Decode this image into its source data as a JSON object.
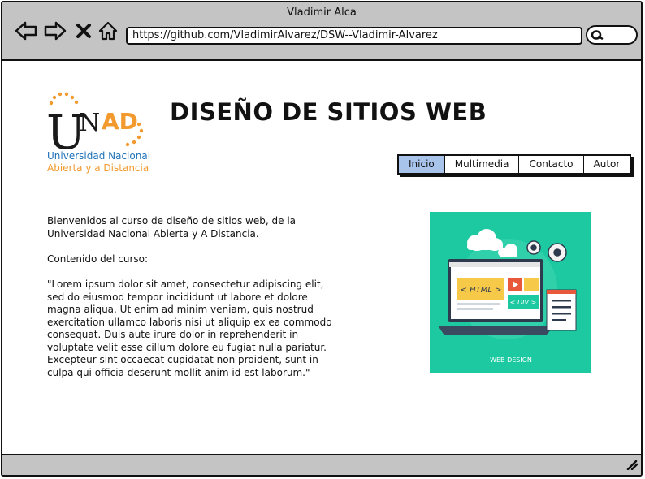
{
  "window": {
    "title": "Vladimir Alca"
  },
  "browser": {
    "url": "https://github.com/VladimirAlvarez/DSW--Vladimir-Alvarez",
    "nav_icons": [
      "back-icon",
      "forward-icon",
      "close-icon",
      "home-icon"
    ],
    "search_icon": "search-icon"
  },
  "logo": {
    "word_u": "U",
    "word_n": "N",
    "word_ad": "AD",
    "line1": "Universidad Nacional",
    "line2": "Abierta y a Distancia",
    "colors": {
      "black": "#1a1a1a",
      "orange": "#f29a2e",
      "blue": "#1f72b8"
    }
  },
  "page": {
    "title": "DISEÑO DE SITIOS WEB"
  },
  "nav": {
    "items": [
      "Inicio",
      "Multimedia",
      "Contacto",
      "Autor"
    ],
    "active": "Inicio",
    "active_color": "#a9c4eb"
  },
  "content": {
    "intro": "Bienvenidos al curso de diseño de sitios web, de la Universidad Nacional Abierta y A Distancia.",
    "course_label": "Contenido del curso:",
    "lorem": "\"Lorem ipsum dolor sit amet, consectetur adipiscing elit, sed do eiusmod tempor incididunt ut labore et dolore magna aliqua. Ut enim ad minim veniam, quis nostrud exercitation ullamco laboris nisi ut aliquip ex ea commodo consequat. Duis aute irure dolor in reprehenderit in voluptate velit esse cillum dolore eu fugiat nulla pariatur. Excepteur sint occaecat cupidatat non proident, sunt in culpa qui officia deserunt mollit anim id est laborum.\""
  },
  "hero": {
    "bg_color": "#1cc9a0",
    "html_tag": "< HTML >",
    "div_tag": "< DIV >",
    "caption": "WEB DESIGN"
  }
}
